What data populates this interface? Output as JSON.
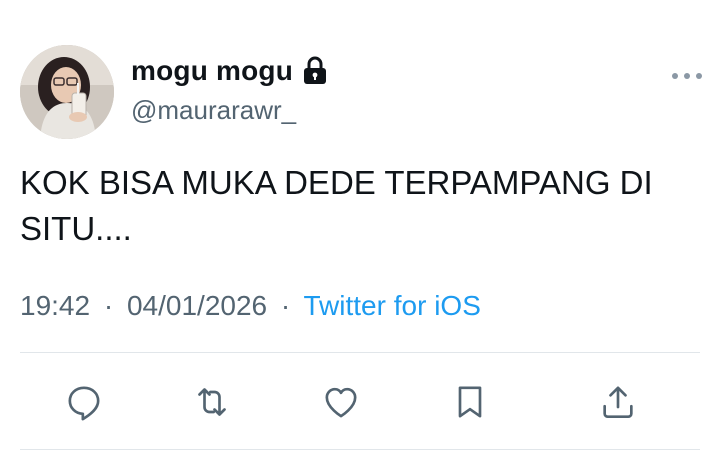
{
  "tweet": {
    "display_name": "mogu mogu",
    "handle": "@maurarawr_",
    "text": "KOK BISA MUKA DEDE TERPAMPANG DI SITU....",
    "time": "19:42",
    "separator": "·",
    "date": "04/01/2026",
    "source": "Twitter for iOS"
  },
  "icons": {
    "protected": "lock-icon",
    "more": "more-options-icon",
    "reply": "reply-icon",
    "retweet": "retweet-icon",
    "like": "heart-icon",
    "bookmark": "bookmark-icon",
    "share": "share-icon"
  },
  "colors": {
    "text": "#0f1419",
    "secondary": "#536471",
    "link": "#1d9bf0",
    "divider": "#e1e6ea"
  }
}
